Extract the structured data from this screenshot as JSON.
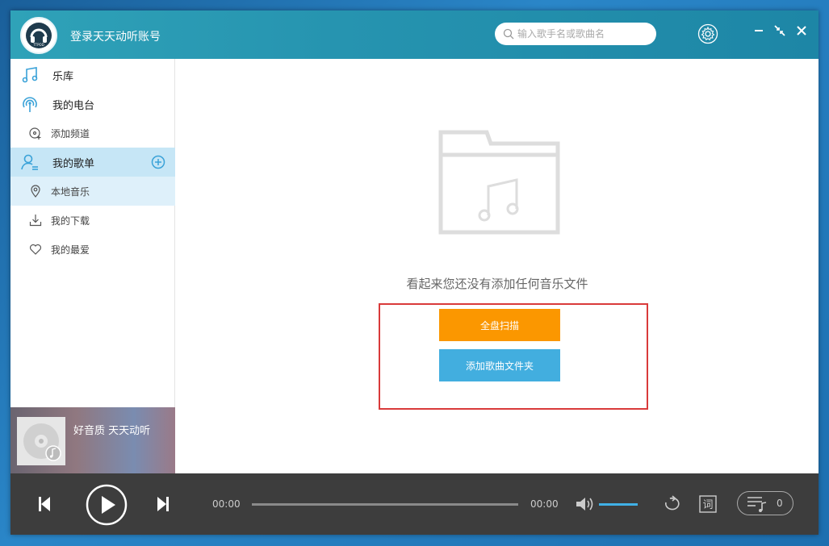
{
  "app": {
    "login_text": "登录天天动听账号",
    "avatar_label": "TTPOD"
  },
  "search": {
    "placeholder": "输入歌手名或歌曲名"
  },
  "sidebar": {
    "items": [
      {
        "label": "乐库",
        "icon": "music-note-icon"
      },
      {
        "label": "我的电台",
        "icon": "radio-icon"
      },
      {
        "label": "添加频道",
        "icon": "add-channel-icon"
      },
      {
        "label": "我的歌单",
        "icon": "user-playlist-icon"
      },
      {
        "label": "本地音乐",
        "icon": "location-pin-icon"
      },
      {
        "label": "我的下载",
        "icon": "download-icon"
      },
      {
        "label": "我的最爱",
        "icon": "heart-icon"
      }
    ]
  },
  "now_playing": {
    "title": "好音质 天天动听"
  },
  "main": {
    "empty_message": "看起来您还没有添加任何音乐文件",
    "scan_button": "全盘扫描",
    "add_folder_button": "添加歌曲文件夹"
  },
  "player": {
    "current_time": "00:00",
    "total_time": "00:00",
    "lyrics_label": "词",
    "queue_count": "0",
    "progress": 0,
    "volume_level": 1.0
  },
  "colors": {
    "titlebar": "#2694b0",
    "scan_button": "#fb9700",
    "add_button": "#42aedf",
    "highlight_border": "#d93a3a",
    "player_bg": "#3d3d3d",
    "volume": "#40b0e6",
    "active_nav": "#c6e6f6"
  }
}
